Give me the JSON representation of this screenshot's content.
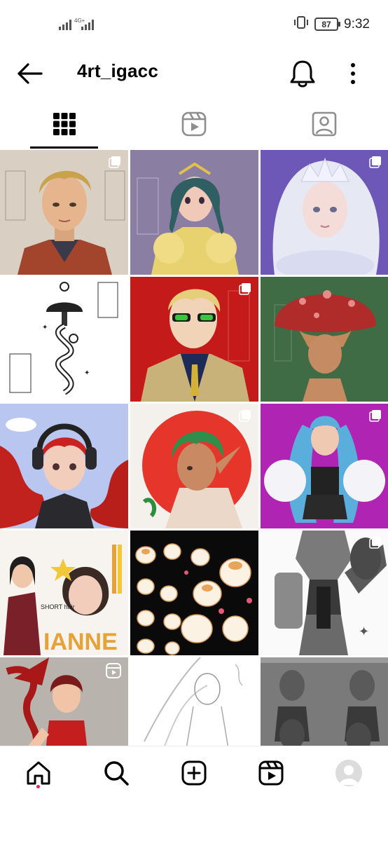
{
  "status_bar": {
    "network_label": "4G+",
    "battery": "87",
    "time": "9:32"
  },
  "header": {
    "username": "4rt_igacc"
  },
  "tabs": [
    {
      "name": "posts-grid",
      "icon": "grid-icon",
      "active": true
    },
    {
      "name": "reels",
      "icon": "reels-icon",
      "active": false
    },
    {
      "name": "tagged",
      "icon": "tagged-user-icon",
      "active": false
    }
  ],
  "grid": {
    "columns": 3,
    "posts": [
      {
        "subject": "man with blond hair, red jacket",
        "badge": "multiple-posts-icon"
      },
      {
        "subject": "girl with teal hair, yellow top",
        "badge": null
      },
      {
        "subject": "white-haired girl with crown",
        "badge": "multiple-posts-icon"
      },
      {
        "subject": "mushroom tattoo sketch",
        "badge": null
      },
      {
        "subject": "man with sunglasses, red background",
        "badge": "multiple-posts-icon"
      },
      {
        "subject": "mushroom head figure, green background",
        "badge": null
      },
      {
        "subject": "red-haired girl with headphones",
        "badge": null
      },
      {
        "subject": "green-haired elf, red circle",
        "badge": "multiple-posts-icon"
      },
      {
        "subject": "blue-haired girl, purple background",
        "badge": "multiple-posts-icon"
      },
      {
        "subject": "character sheet 'IANNE'",
        "badge": null
      },
      {
        "subject": "hamster sticker sheet",
        "badge": null
      },
      {
        "subject": "armored mech sketch",
        "badge": "multiple-posts-icon"
      },
      {
        "subject": "red dancer with axe",
        "badge": "reel-icon"
      },
      {
        "subject": "line art sketch",
        "badge": null
      },
      {
        "subject": "greyscale figures",
        "badge": null
      }
    ],
    "tile_texts": {
      "ianne_title": "IANNE",
      "short_hair": "SHORT hair"
    }
  },
  "bottom_nav": [
    {
      "name": "home",
      "icon": "home-icon",
      "active": true
    },
    {
      "name": "search",
      "icon": "search-icon",
      "active": false
    },
    {
      "name": "create",
      "icon": "plus-square-icon",
      "active": false
    },
    {
      "name": "reels",
      "icon": "reels-icon",
      "active": false
    },
    {
      "name": "profile",
      "icon": "avatar-icon",
      "active": false
    }
  ],
  "colors": {
    "accent_dot": "#e0245e",
    "text": "#000000",
    "tab_inactive": "#8e8e8e"
  }
}
